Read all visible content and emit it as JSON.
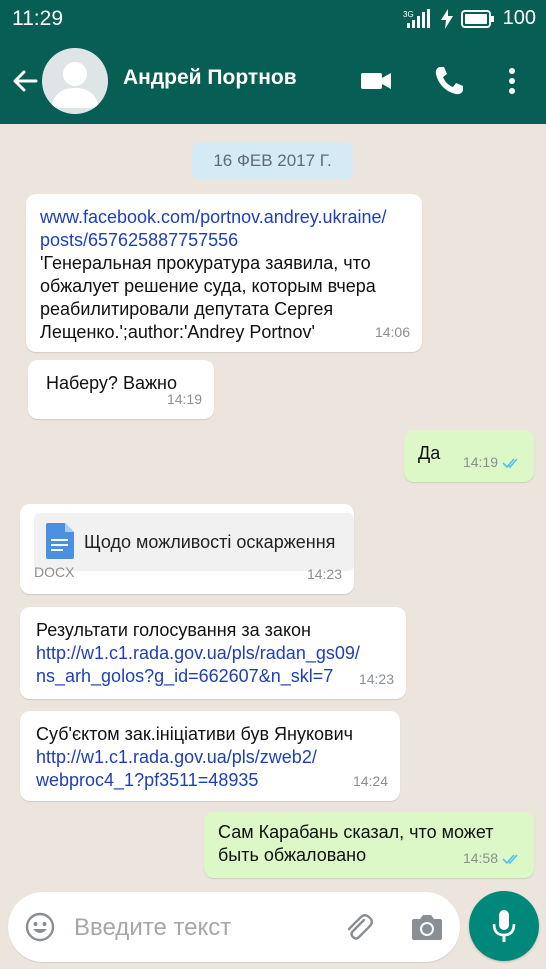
{
  "status_bar": {
    "time": "11:29",
    "network": "3G",
    "battery": "100"
  },
  "header": {
    "contact_name": "Андрей Портнов",
    "icons": [
      "back-arrow-icon",
      "avatar",
      "video-call-icon",
      "phone-icon",
      "more-options-icon"
    ]
  },
  "chat": {
    "date_chip": "16 ФЕВ 2017 Г.",
    "messages": [
      {
        "direction": "incoming",
        "lines": [
          {
            "text": "www.facebook.com/portnov.andrey.ukraine/",
            "link": true
          },
          {
            "text": "posts/657625887757556",
            "link": true
          },
          {
            "text": "'Генеральная прокуратура заявила, что",
            "link": false
          },
          {
            "text": "обжалует решение суда, которым вчера",
            "link": false
          },
          {
            "text": "реабилитировали депутата Сергея",
            "link": false
          },
          {
            "text": "Лещенко.';author:'Andrey Portnov'",
            "link": false
          }
        ],
        "time": "14:06"
      },
      {
        "direction": "incoming",
        "lines": [
          {
            "text": "Наберу? Важно",
            "link": false
          }
        ],
        "time": "14:19"
      },
      {
        "direction": "outgoing",
        "lines": [
          {
            "text": "Да",
            "link": false
          }
        ],
        "time": "14:19",
        "status": "read"
      },
      {
        "direction": "incoming",
        "document": {
          "title": "Щодо можливості оскарження",
          "type": "DOCX"
        },
        "time": "14:23"
      },
      {
        "direction": "incoming",
        "lines": [
          {
            "text": "Результати голосування за закон",
            "link": false
          },
          {
            "text": "http://w1.c1.rada.gov.ua/pls/radan_gs09/",
            "link": true
          },
          {
            "text": "ns_arh_golos?g_id=662607&n_skl=7",
            "link": true
          }
        ],
        "time": "14:23"
      },
      {
        "direction": "incoming",
        "lines": [
          {
            "text": "Суб'єктом зак.ініціативи був Янукович",
            "link": false
          },
          {
            "text": "http://w1.c1.rada.gov.ua/pls/zweb2/",
            "link": true
          },
          {
            "text": "webproc4_1?pf3511=48935",
            "link": true
          }
        ],
        "time": "14:24"
      },
      {
        "direction": "outgoing",
        "lines": [
          {
            "text": "Сам Карабань сказал, что может",
            "link": false
          },
          {
            "text": "быть обжаловано",
            "link": false
          }
        ],
        "time": "14:58",
        "status": "read"
      }
    ]
  },
  "input_bar": {
    "placeholder": "Введите текст",
    "icons": [
      "emoji-icon",
      "attach-icon",
      "camera-icon",
      "mic-icon"
    ]
  },
  "colors": {
    "header": "#075e54",
    "chat_background": "#ece5dd",
    "incoming_bubble": "#ffffff",
    "outgoing_bubble": "#dcf8c6",
    "link": "#1f3fb8",
    "read_ticks": "#4fc3f7",
    "mic_button": "#00897b"
  }
}
